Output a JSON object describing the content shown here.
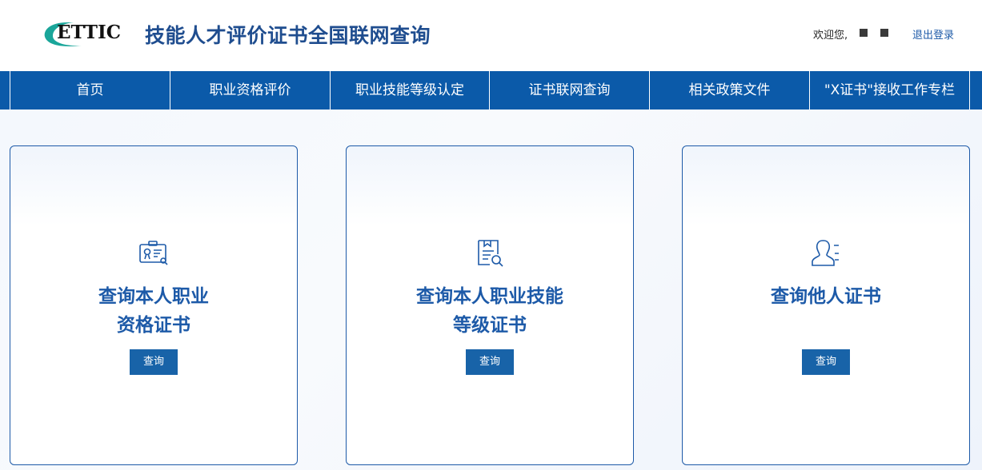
{
  "header": {
    "logo_text": "ETTIC",
    "site_title": "技能人才评价证书全国联网查询",
    "welcome": "欢迎您,",
    "logout": "退出登录"
  },
  "nav": {
    "items": [
      {
        "label": "首页"
      },
      {
        "label": "职业资格评价"
      },
      {
        "label": "职业技能等级认定"
      },
      {
        "label": "证书联网查询"
      },
      {
        "label": "相关政策文件"
      },
      {
        "label": "\"X证书\"接收工作专栏"
      }
    ]
  },
  "cards": [
    {
      "title_line1": "查询本人职业",
      "title_line2": "资格证书",
      "button": "查询",
      "icon": "certificate-search-icon"
    },
    {
      "title_line1": "查询本人职业技能",
      "title_line2": "等级证书",
      "button": "查询",
      "icon": "document-search-icon"
    },
    {
      "title_line1": "查询他人证书",
      "title_line2": "",
      "button": "查询",
      "icon": "user-list-icon"
    }
  ],
  "colors": {
    "nav_bg": "#0b5aa9",
    "title": "#1d5aa8",
    "button": "#1863a8",
    "logo_teal": "#1aa69a"
  }
}
